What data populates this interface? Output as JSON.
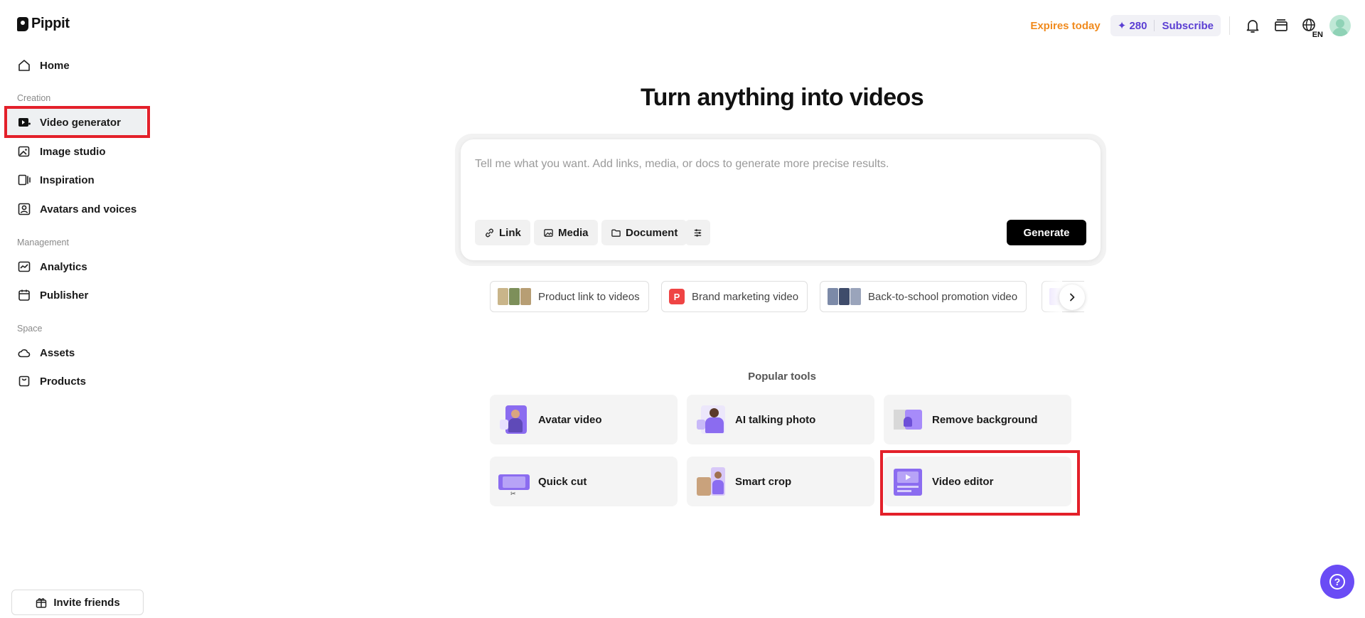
{
  "app": {
    "name": "Pippit"
  },
  "sidebar": {
    "home": "Home",
    "sections": {
      "creation": "Creation",
      "management": "Management",
      "space": "Space"
    },
    "items": {
      "video_generator": "Video generator",
      "image_studio": "Image studio",
      "inspiration": "Inspiration",
      "avatars_voices": "Avatars and voices",
      "analytics": "Analytics",
      "publisher": "Publisher",
      "assets": "Assets",
      "products": "Products"
    },
    "invite": "Invite friends"
  },
  "header": {
    "expires": "Expires today",
    "credits": "280",
    "subscribe": "Subscribe",
    "icons": [
      "bell-icon",
      "wallet-icon",
      "language-icon",
      "avatar"
    ],
    "language_code": "EN"
  },
  "main": {
    "headline": "Turn anything into videos",
    "prompt_placeholder": "Tell me what you want. Add links, media, or docs to generate more precise results.",
    "chips": {
      "link": "Link",
      "media": "Media",
      "document": "Document"
    },
    "generate": "Generate",
    "suggestions": [
      "Product link to videos",
      "Brand marketing video",
      "Back-to-school promotion video"
    ],
    "suggestion_badge": "P",
    "popular_label": "Popular tools",
    "tools": {
      "avatar_video": "Avatar video",
      "ai_talking_photo": "AI talking photo",
      "remove_background": "Remove background",
      "quick_cut": "Quick cut",
      "smart_crop": "Smart crop",
      "video_editor": "Video editor"
    }
  },
  "colors": {
    "accent": "#5b3fd3",
    "expires": "#f08a1d",
    "highlight": "#e3202a",
    "help": "#6a4cf5",
    "tool_purple": "#8b6cf0"
  },
  "help": "?"
}
